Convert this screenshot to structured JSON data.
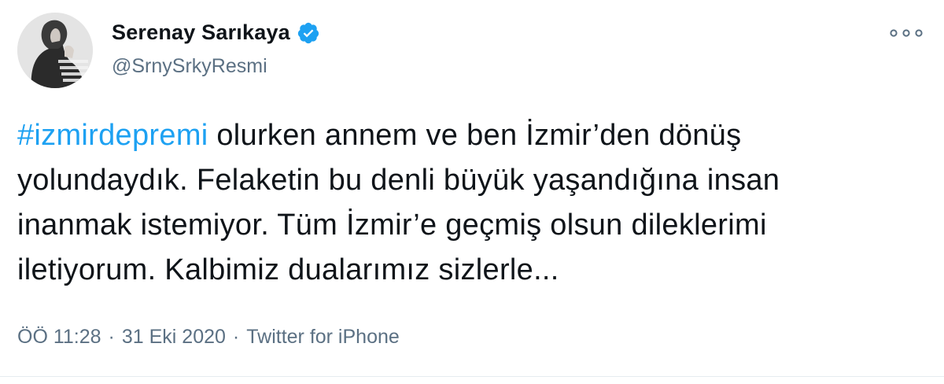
{
  "author": {
    "name": "Serenay Sarıkaya",
    "handle": "@SrnySrkyResmi",
    "verified_color": "#1da1f2"
  },
  "menu": {
    "icon": "more-horizontal-icon"
  },
  "tweet": {
    "hashtag": "#izmirdepremi",
    "text_line1": " olurken annem ve ben İzmir’den dönüş",
    "text_line2": "yolundaydık. Felaketin bu denli büyük yaşandığına insan",
    "text_line3": "inanmak istemiyor. Tüm İzmir’e geçmiş olsun dileklerimi",
    "text_line4": "iletiyorum. Kalbimiz dualarımız sizlerle...",
    "hashtag_color": "#1da1f2"
  },
  "meta": {
    "time": "ÖÖ 11:28",
    "separator": "·",
    "date": "31 Eki 2020",
    "source": "Twitter for iPhone"
  }
}
